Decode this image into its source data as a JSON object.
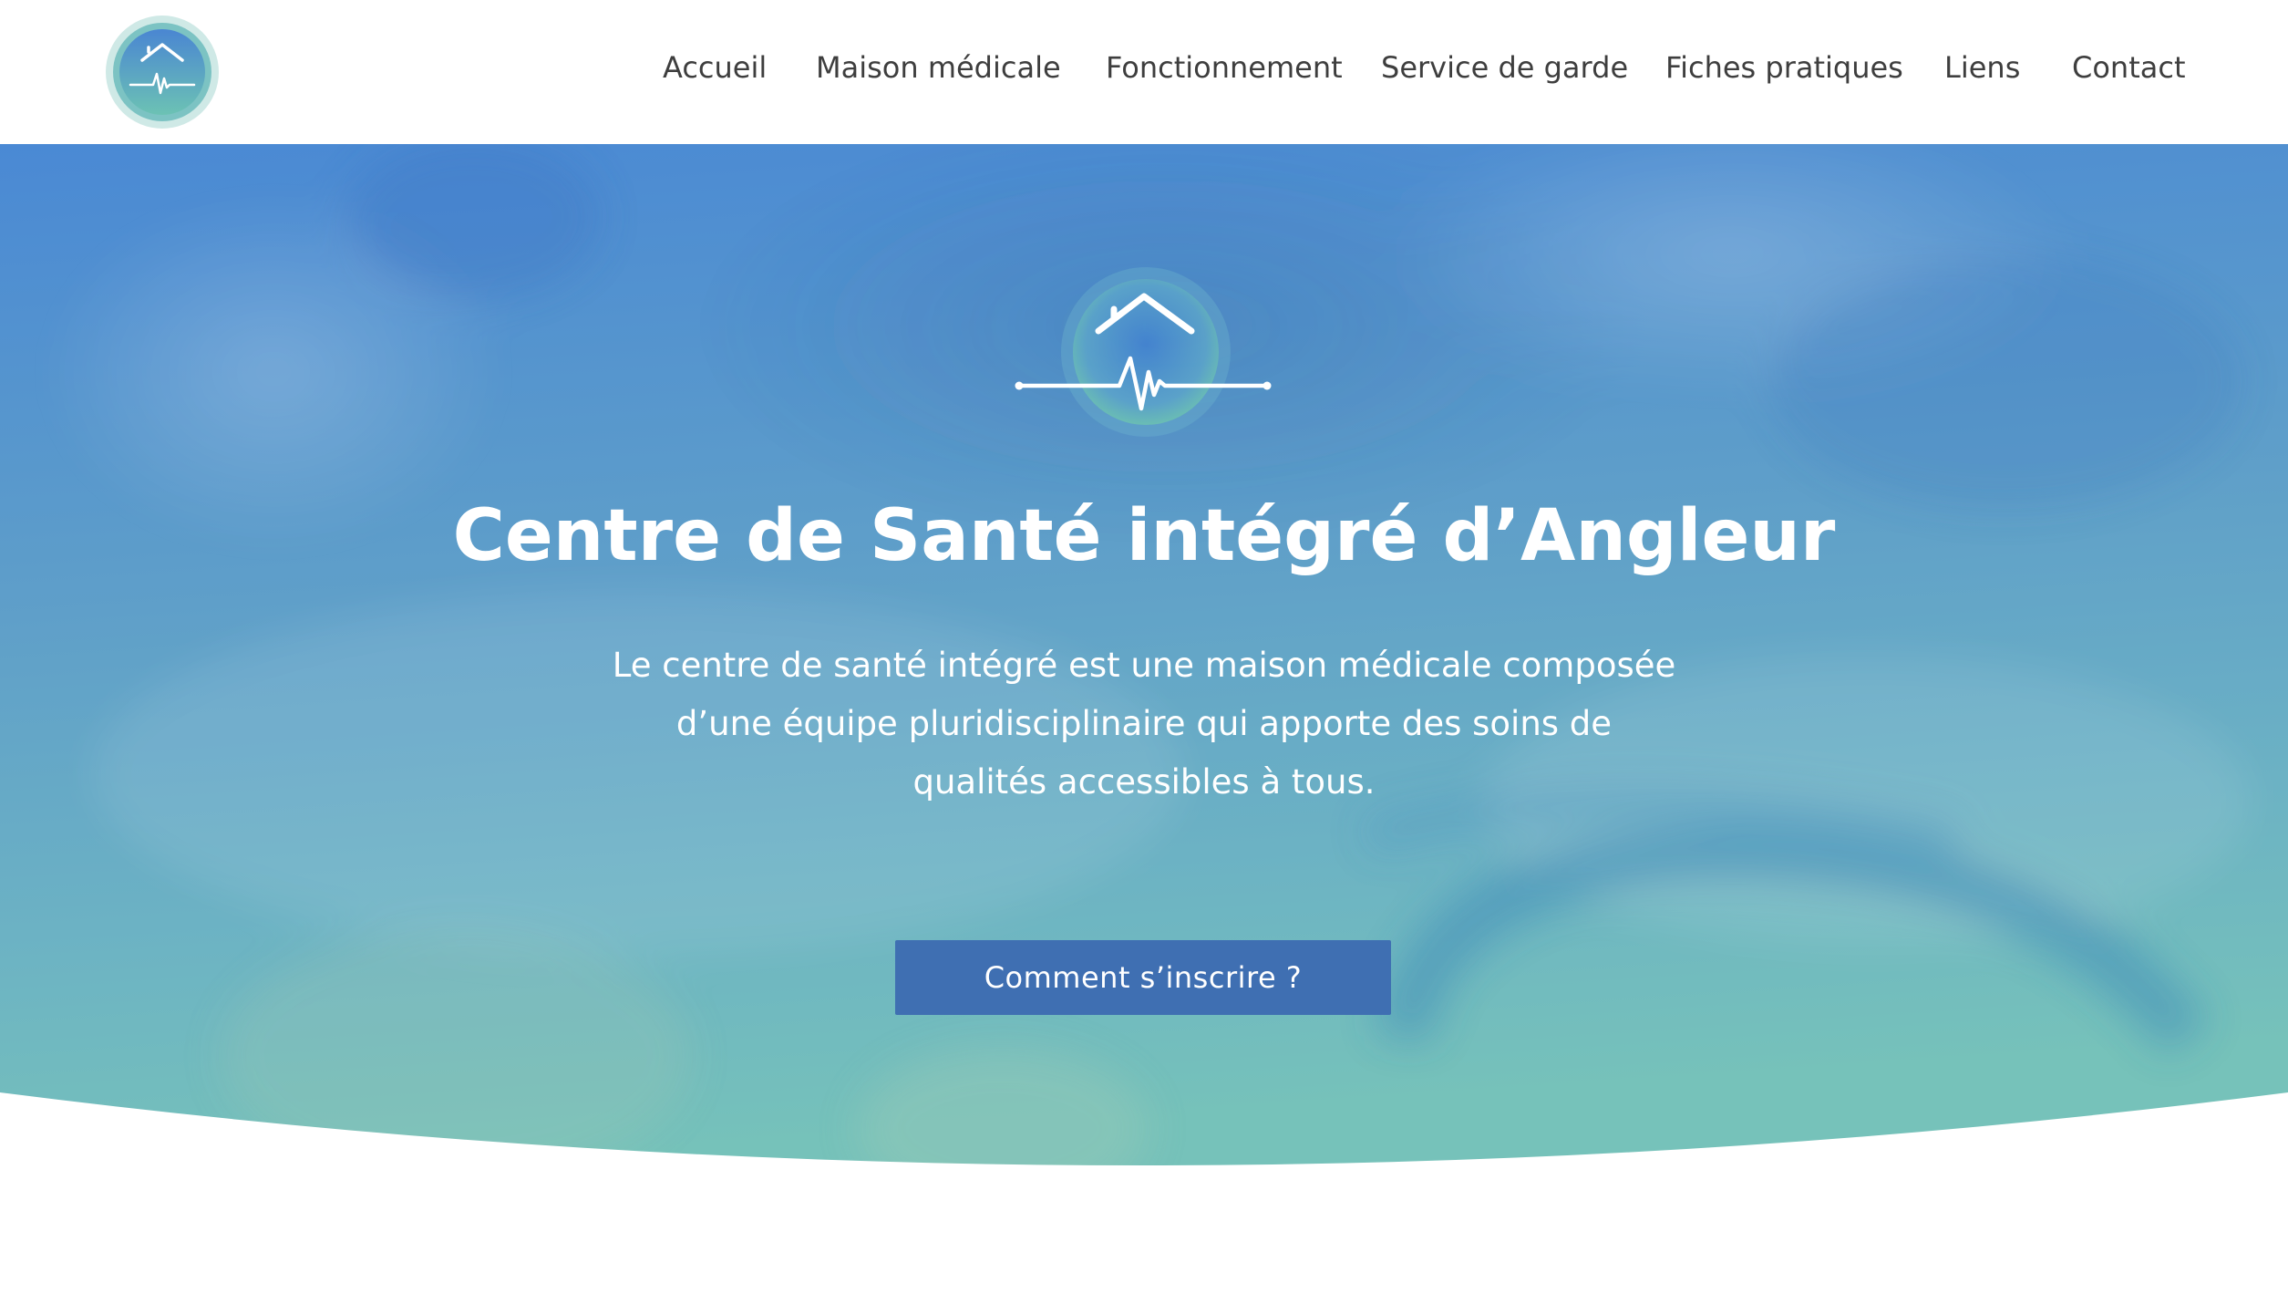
{
  "header": {
    "logo_icon": "house-heartbeat-icon",
    "nav": [
      {
        "label": "Accueil"
      },
      {
        "label": "Maison médicale"
      },
      {
        "label": "Fonctionnement"
      },
      {
        "label": "Service de garde"
      },
      {
        "label": "Fiches pratiques"
      },
      {
        "label": "Liens"
      },
      {
        "label": "Contact"
      }
    ]
  },
  "hero": {
    "emblem_icon": "house-heartbeat-icon",
    "title": "Centre de Santé intégré d’Angleur",
    "description_lines": [
      "Le centre de santé intégré est une maison médicale composée",
      "d’une équipe pluridisciplinaire qui apporte des soins de",
      "qualités accessibles à tous."
    ],
    "cta_label": "Comment s’inscrire ?"
  },
  "colors": {
    "gradient_top": "#4a89d4",
    "gradient_bottom": "#73bfbb",
    "cta": "#3f6fb2",
    "nav_text": "#3e3e3e"
  }
}
